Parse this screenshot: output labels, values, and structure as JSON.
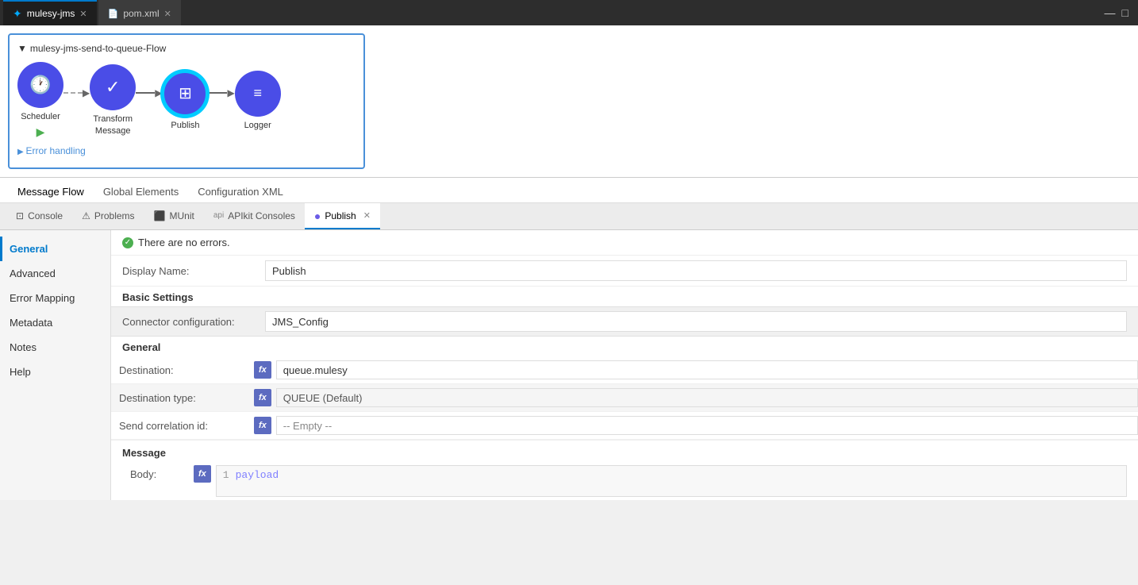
{
  "topTabs": [
    {
      "id": "mule-tab",
      "label": "mulesy-jms",
      "icon": "mule-icon",
      "active": true,
      "closable": true
    },
    {
      "id": "pom-tab",
      "label": "pom.xml",
      "icon": "xml-icon",
      "active": false,
      "closable": true
    }
  ],
  "windowControls": {
    "minimize": "—",
    "maximize": "□"
  },
  "flow": {
    "title": "mulesy-jms-send-to-queue-Flow",
    "nodes": [
      {
        "id": "scheduler",
        "label": "Scheduler",
        "icon": "🕐",
        "sublabel": "▶"
      },
      {
        "id": "transform",
        "label": "Transform\nMessage",
        "icon": "✓"
      },
      {
        "id": "publish",
        "label": "Publish",
        "icon": "⊟",
        "selected": true
      },
      {
        "id": "logger",
        "label": "Logger",
        "icon": "≡"
      }
    ],
    "errorHandling": "Error handling"
  },
  "subNav": {
    "items": [
      "Message Flow",
      "Global Elements",
      "Configuration XML"
    ],
    "active": "Message Flow"
  },
  "bottomTabs": [
    {
      "id": "console",
      "label": "Console",
      "icon": "console-icon",
      "active": false
    },
    {
      "id": "problems",
      "label": "Problems",
      "icon": "problems-icon",
      "active": false
    },
    {
      "id": "munit",
      "label": "MUnit",
      "icon": "munit-icon",
      "active": false
    },
    {
      "id": "apikit",
      "label": "APIkit Consoles",
      "icon": "apikit-icon",
      "active": false
    },
    {
      "id": "publish",
      "label": "Publish",
      "icon": "publish-icon",
      "active": true,
      "closable": true
    }
  ],
  "sidebar": {
    "items": [
      {
        "id": "general",
        "label": "General",
        "active": true
      },
      {
        "id": "advanced",
        "label": "Advanced",
        "active": false
      },
      {
        "id": "error-mapping",
        "label": "Error Mapping",
        "active": false
      },
      {
        "id": "metadata",
        "label": "Metadata",
        "active": false
      },
      {
        "id": "notes",
        "label": "Notes",
        "active": false
      },
      {
        "id": "help",
        "label": "Help",
        "active": false
      }
    ]
  },
  "form": {
    "noErrors": "There are no errors.",
    "displayNameLabel": "Display Name:",
    "displayNameValue": "Publish",
    "basicSettingsLabel": "Basic Settings",
    "connectorConfigLabel": "Connector configuration:",
    "connectorConfigValue": "JMS_Config",
    "generalLabel": "General",
    "destinationLabel": "Destination:",
    "destinationValue": "queue.mulesy",
    "destinationTypeLabel": "Destination type:",
    "destinationTypeValue": "QUEUE (Default)",
    "correlationIdLabel": "Send correlation id:",
    "correlationIdValue": "-- Empty --",
    "messageLabel": "Message",
    "bodyLabel": "Body:",
    "bodyLineNum": "1",
    "bodyValue": "payload"
  }
}
